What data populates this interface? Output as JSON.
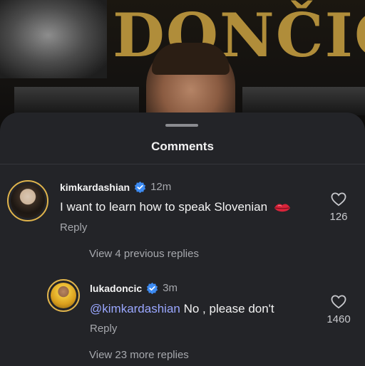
{
  "background": {
    "title": "DONČIĆ"
  },
  "sheet": {
    "title": "Comments"
  },
  "comments": [
    {
      "username": "kimkardashian",
      "time": "12m",
      "text": "I want to learn how to speak Slovenian",
      "emoji": "lips",
      "reply_label": "Reply",
      "like_count": "126",
      "view_replies": "View 4 previous replies"
    },
    {
      "username": "lukadoncic",
      "time": "3m",
      "mention": "@kimkardashian",
      "text": " No , please don't",
      "reply_label": "Reply",
      "like_count": "1460",
      "view_replies": "View 23 more replies"
    }
  ],
  "colors": {
    "sheet_bg": "#232428",
    "verified": "#3d8bf2",
    "mention": "#9aa7ff",
    "avatar_ring": "#e0b44c"
  }
}
